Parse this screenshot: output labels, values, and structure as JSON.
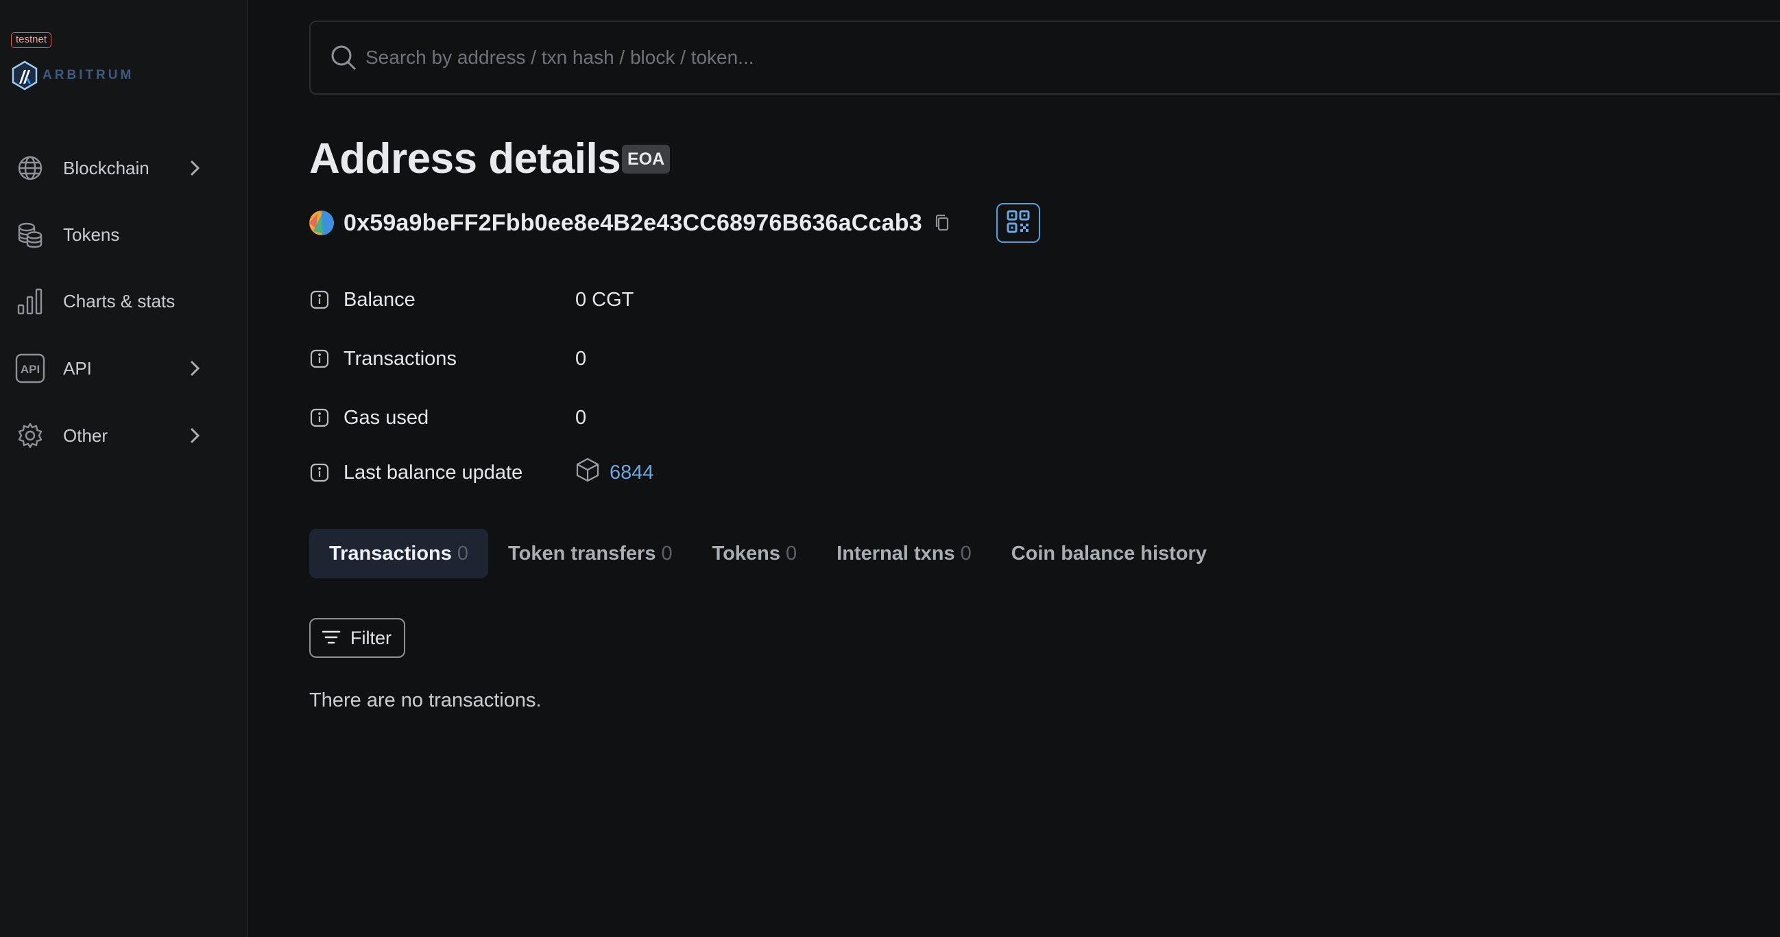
{
  "sidebar": {
    "network_badge": "testnet",
    "logo_text": "ARBITRUM",
    "items": [
      {
        "label": "Blockchain",
        "icon": "globe-icon",
        "has_chevron": true
      },
      {
        "label": "Tokens",
        "icon": "coins-icon",
        "has_chevron": false
      },
      {
        "label": "Charts & stats",
        "icon": "bar-chart-icon",
        "has_chevron": false
      },
      {
        "label": "API",
        "icon": "api-icon",
        "has_chevron": true
      },
      {
        "label": "Other",
        "icon": "gear-icon",
        "has_chevron": true
      }
    ]
  },
  "search": {
    "placeholder": "Search by address / txn hash / block / token...",
    "value": ""
  },
  "page": {
    "title": "Address details",
    "badge": "EOA"
  },
  "address": {
    "hash": "0x59a9beFF2Fbb0ee8e4B2e43CC68976B636aCcab3"
  },
  "details": {
    "balance_label": "Balance",
    "balance_value": "0 CGT",
    "transactions_label": "Transactions",
    "transactions_value": "0",
    "gas_label": "Gas used",
    "gas_value": "0",
    "last_update_label": "Last balance update",
    "last_update_block": "6844"
  },
  "tabs": [
    {
      "label": "Transactions",
      "count": "0",
      "active": true
    },
    {
      "label": "Token transfers",
      "count": "0",
      "active": false
    },
    {
      "label": "Tokens",
      "count": "0",
      "active": false
    },
    {
      "label": "Internal txns",
      "count": "0",
      "active": false
    },
    {
      "label": "Coin balance history",
      "count": "",
      "active": false
    }
  ],
  "filter": {
    "label": "Filter"
  },
  "empty_message": "There are no transactions.",
  "colors": {
    "background": "#101112",
    "sidebar": "#141517",
    "link": "#6aa7e0",
    "qr_accent": "#5a9fd8",
    "active_tab": "#1d2533"
  }
}
